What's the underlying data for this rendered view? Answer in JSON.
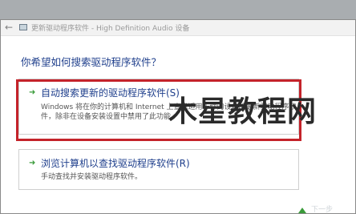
{
  "window": {
    "title": "更新驱动程序软件 - High Definition Audio 设备",
    "back_icon": "back-arrow-icon",
    "device_icon": "audio-device-icon"
  },
  "main": {
    "question": "你希望如何搜索驱动程序软件？",
    "options": [
      {
        "icon": "green-arrow-icon",
        "title": "自动搜索更新的驱动程序软件(S)",
        "description": "Windows 将在你的计算机和 Internet 上查找适用于你的设备的最新驱动程序软件，除非在设备安装设置中禁用了此功能。"
      },
      {
        "icon": "green-arrow-icon",
        "title": "浏览计算机以查找驱动程序软件(R)",
        "description": "手动查找并安装驱动程序软件。"
      }
    ]
  },
  "overlay": {
    "watermark": "木星教程网",
    "highlight_color": "#c4232a"
  },
  "footer": {
    "next_label": "下一步"
  },
  "colors": {
    "link_blue": "#1f3f8c",
    "arrow_green": "#3a9b3a"
  }
}
